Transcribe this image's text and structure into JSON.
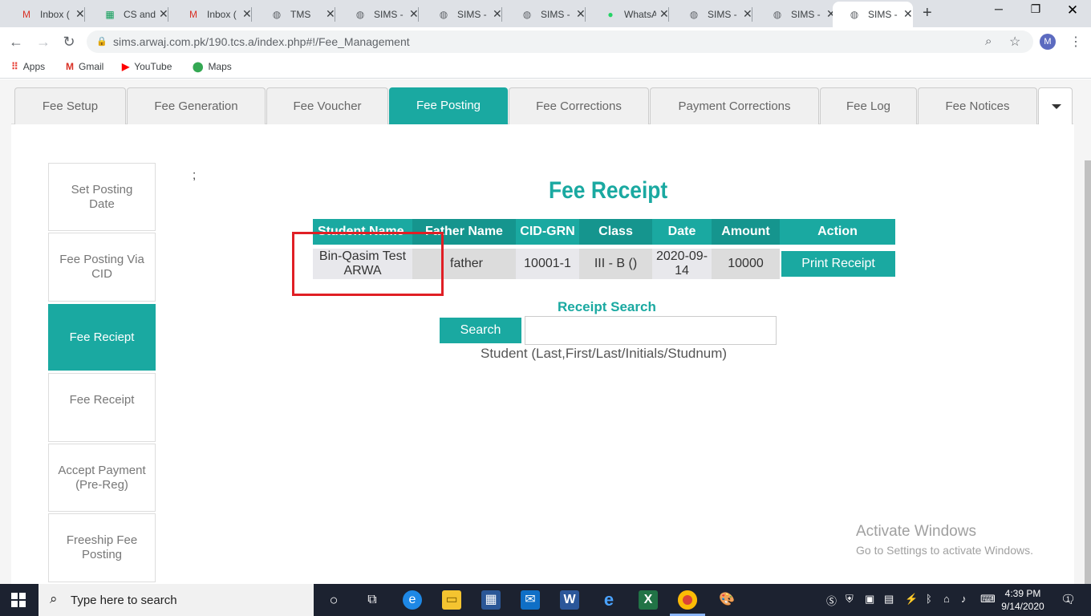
{
  "browser": {
    "tabs": [
      {
        "title": "Inbox (",
        "icon": "gmail-icon",
        "glyph": "M",
        "color": "#d93025"
      },
      {
        "title": "CS and",
        "icon": "sheets-icon",
        "glyph": "▦",
        "color": "#0f9d58"
      },
      {
        "title": "Inbox (",
        "icon": "gmail-icon",
        "glyph": "M",
        "color": "#d93025"
      },
      {
        "title": "TMS",
        "icon": "globe-icon",
        "glyph": "◍",
        "color": "#5f6368"
      },
      {
        "title": "SIMS -",
        "icon": "globe-icon",
        "glyph": "◍",
        "color": "#5f6368"
      },
      {
        "title": "SIMS -",
        "icon": "globe-icon",
        "glyph": "◍",
        "color": "#5f6368"
      },
      {
        "title": "SIMS -",
        "icon": "globe-icon",
        "glyph": "◍",
        "color": "#5f6368"
      },
      {
        "title": "WhatsA",
        "icon": "whatsapp-icon",
        "glyph": "●",
        "color": "#25d366"
      },
      {
        "title": "SIMS -",
        "icon": "globe-icon",
        "glyph": "◍",
        "color": "#5f6368"
      },
      {
        "title": "SIMS -",
        "icon": "globe-icon",
        "glyph": "◍",
        "color": "#5f6368"
      },
      {
        "title": "SIMS -",
        "icon": "globe-icon",
        "glyph": "◍",
        "color": "#5f6368"
      }
    ],
    "active_tab": 10,
    "url": "sims.arwaj.com.pk/190.tcs.a/index.php#!/Fee_Management",
    "profile_initial": "M",
    "bookmarks": [
      {
        "label": "Apps",
        "icon": "apps-icon"
      },
      {
        "label": "Gmail",
        "icon": "gmail-icon"
      },
      {
        "label": "YouTube",
        "icon": "youtube-icon"
      },
      {
        "label": "Maps",
        "icon": "maps-icon"
      }
    ]
  },
  "nav_tabs": [
    "Fee Setup",
    "Fee Generation",
    "Fee Voucher",
    "Fee Posting",
    "Fee Corrections",
    "Payment Corrections",
    "Fee Log",
    "Fee Notices"
  ],
  "active_nav_tab": "Fee Posting",
  "sidebar": [
    "Set Posting Date",
    "Fee Posting Via CID",
    "Fee Reciept",
    "Fee Receipt",
    "Accept Payment (Pre-Reg)",
    "Freeship Fee Posting"
  ],
  "active_sidebar": "Fee Reciept",
  "stray_text": ";",
  "receipt": {
    "title": "Fee Receipt",
    "columns": [
      "Student Name",
      "Father Name",
      "CID-GRN",
      "Class",
      "Date",
      "Amount",
      "Action"
    ],
    "row": {
      "student_name": "Bin-Qasim Test ARWA",
      "father_name": "father",
      "cid_grn": "10001-1",
      "class": "III - B ()",
      "date": "2020-09-14",
      "amount": "10000",
      "action": "Print Receipt"
    }
  },
  "receipt_search": {
    "title": "Receipt Search",
    "button": "Search",
    "value": "",
    "hint": "Student (Last,First/Last/Initials/Studnum)"
  },
  "watermark": {
    "line1": "Activate Windows",
    "line2": "Go to Settings to activate Windows."
  },
  "taskbar": {
    "search_placeholder": "Type here to search",
    "time": "4:39 PM",
    "date": "9/14/2020",
    "notification_count": "1"
  },
  "colors": {
    "accent": "#1aa9a1",
    "highlight_box": "#e01f25"
  }
}
